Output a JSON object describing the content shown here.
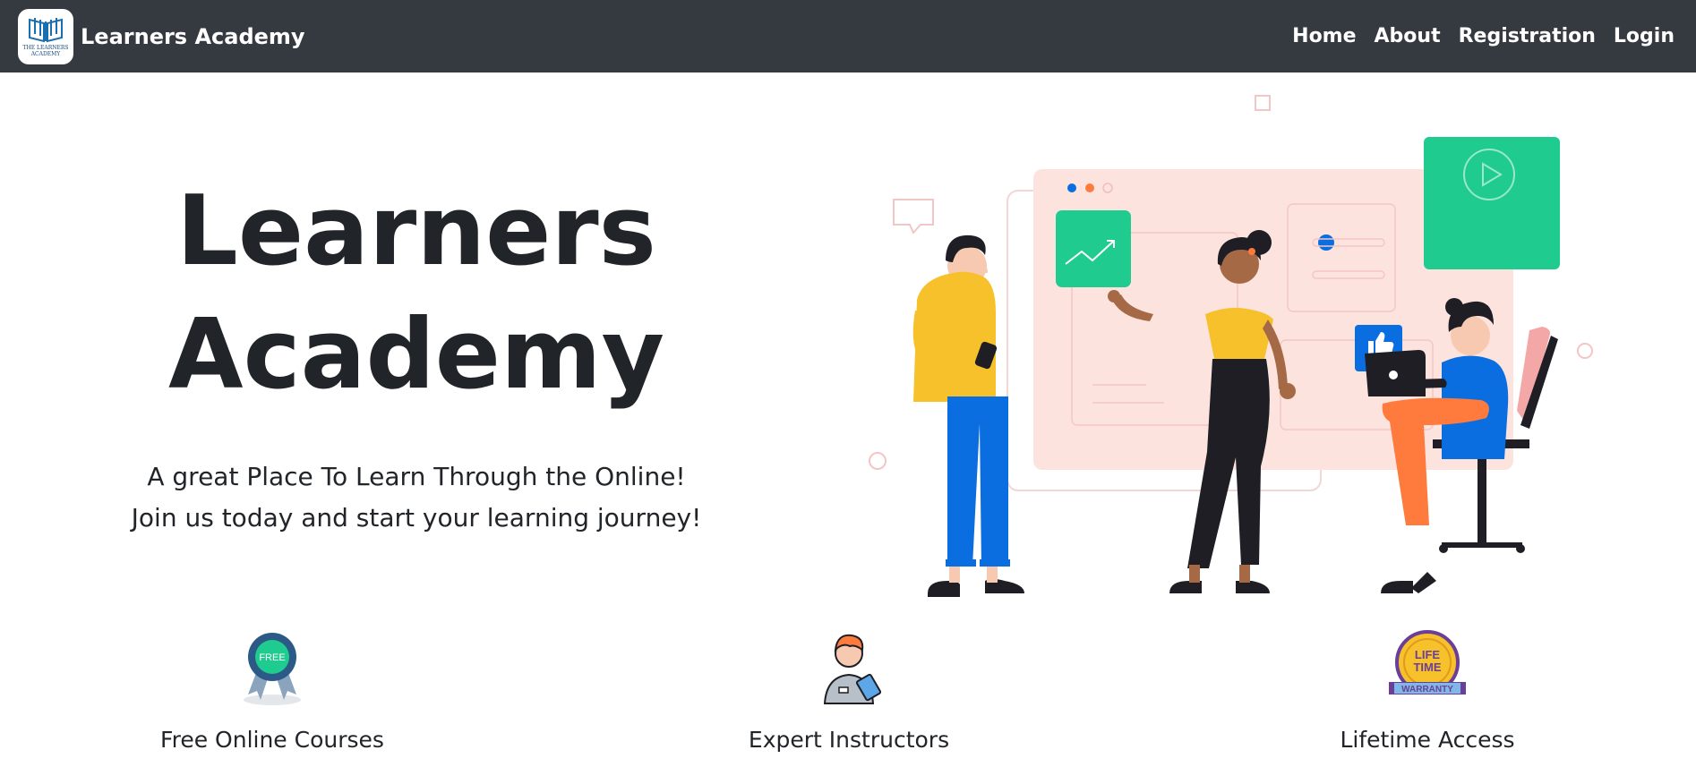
{
  "navbar": {
    "brand_name": "Learners Academy",
    "logo_text": "THE LEARNERS ACADEMY",
    "links": [
      "Home",
      "About",
      "Registration",
      "Login"
    ]
  },
  "hero": {
    "title_line1": "Learners",
    "title_line2": "Academy",
    "subtitle_line1": "A great Place To Learn Through the Online!",
    "subtitle_line2": "Join us today and start your learning journey!"
  },
  "features": [
    {
      "label": "Free Online Courses",
      "icon": "free-ribbon-icon",
      "badge_text": "FREE"
    },
    {
      "label": "Expert Instructors",
      "icon": "instructor-icon"
    },
    {
      "label": "Lifetime Access",
      "icon": "lifetime-warranty-icon",
      "badge_text_1": "LIFE",
      "badge_text_2": "TIME",
      "badge_text_3": "WARRANTY"
    }
  ],
  "colors": {
    "navbar_bg": "#343a40",
    "accent_green": "#1fcb8f",
    "accent_blue": "#0a6ee0",
    "accent_yellow": "#f6c12b",
    "accent_orange": "#ff7a3d"
  }
}
